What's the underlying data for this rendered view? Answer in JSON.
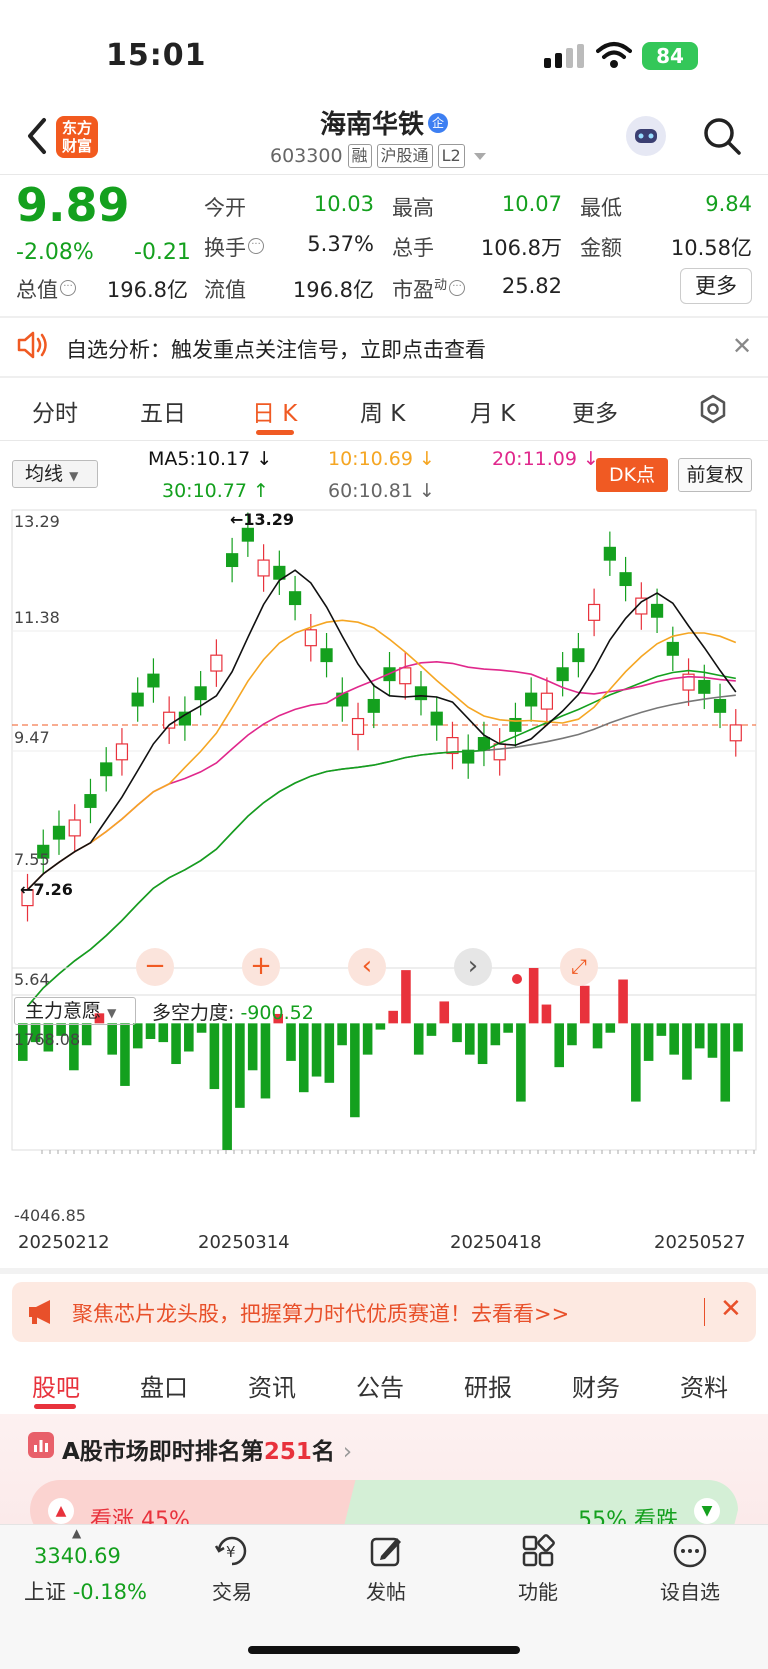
{
  "status_bar": {
    "time": "15:01",
    "battery": "84"
  },
  "header": {
    "stock_name": "海南华铁",
    "name_badge": "企",
    "code": "603300",
    "tags": [
      "融",
      "沪股通",
      "L2"
    ],
    "logo_line1": "东方",
    "logo_line2": "财富"
  },
  "quote": {
    "price": "9.89",
    "change_pct": "-2.08%",
    "change": "-0.21",
    "stats": [
      {
        "label": "今开",
        "value": "10.03"
      },
      {
        "label": "最高",
        "value": "10.07"
      },
      {
        "label": "最低",
        "value": "9.84"
      },
      {
        "label": "换手",
        "value": "5.37%"
      },
      {
        "label": "总手",
        "value": "106.8万"
      },
      {
        "label": "金额",
        "value": "10.58亿"
      },
      {
        "label": "总值",
        "value": "196.8亿"
      },
      {
        "label": "流值",
        "value": "196.8亿"
      },
      {
        "label": "市盈",
        "label_sup": "动",
        "value": "25.82"
      }
    ],
    "more_label": "更多"
  },
  "alert": {
    "text": "自选分析：触发重点关注信号，立即点击查看"
  },
  "kline_tabs": [
    {
      "label": "分时",
      "active": false
    },
    {
      "label": "五日",
      "active": false
    },
    {
      "label": "日 K",
      "active": true
    },
    {
      "label": "周 K",
      "active": false
    },
    {
      "label": "月 K",
      "active": false
    },
    {
      "label": "更多",
      "active": false
    }
  ],
  "ma_legend": {
    "selector": "均线",
    "ma5": "MA5:10.17",
    "ma10": "10:10.69",
    "ma20": "20:11.09",
    "ma30": "30:10.77",
    "ma60": "60:10.81",
    "dk_label": "DK点",
    "fq_label": "前复权",
    "colors": {
      "ma5": "#111111",
      "ma10": "#f5a623",
      "ma20": "#e0288c",
      "ma30": "#14a01e",
      "ma60": "#777777"
    }
  },
  "price_axis": {
    "top": "13.29",
    "mid1": "11.38",
    "mid2": "9.47",
    "low": "7.55",
    "bottom": "5.64",
    "high_mark": "13.29",
    "low_mark": "7.26"
  },
  "indicator": {
    "selector": "主力意愿",
    "label": "多空力度:",
    "value": "-900.52",
    "max": "1768.08",
    "min": "-4046.85"
  },
  "dates": [
    "20250212",
    "20250314",
    "20250418",
    "20250527"
  ],
  "banner": {
    "text": "聚焦芯片龙头股，把握算力时代优质赛道！去看看>>"
  },
  "bottom_tabs": [
    {
      "label": "股吧",
      "active": true
    },
    {
      "label": "盘口",
      "active": false
    },
    {
      "label": "资讯",
      "active": false
    },
    {
      "label": "公告",
      "active": false
    },
    {
      "label": "研报",
      "active": false
    },
    {
      "label": "财务",
      "active": false
    },
    {
      "label": "资料",
      "active": false
    }
  ],
  "ranking": {
    "prefix": "A股市场即时排名第",
    "rank": "251",
    "suffix": "名"
  },
  "sentiment": {
    "up_label": "看涨 45%",
    "down_label": "55% 看跌",
    "up_pct": 45,
    "down_pct": 55
  },
  "index": {
    "value": "3340.69",
    "name": "上证",
    "change": "-0.18%"
  },
  "nav": [
    {
      "label": "交易",
      "icon": "trade-icon"
    },
    {
      "label": "发帖",
      "icon": "post-icon"
    },
    {
      "label": "功能",
      "icon": "apps-icon"
    },
    {
      "label": "设自选",
      "icon": "more-icon"
    }
  ],
  "chart_data": {
    "type": "candlestick",
    "price_range": [
      5.64,
      13.29
    ],
    "indicator_range": [
      -4046.85,
      1768.08
    ],
    "last_close": 9.89,
    "x_start": "20250212",
    "x_end": "20250527"
  }
}
